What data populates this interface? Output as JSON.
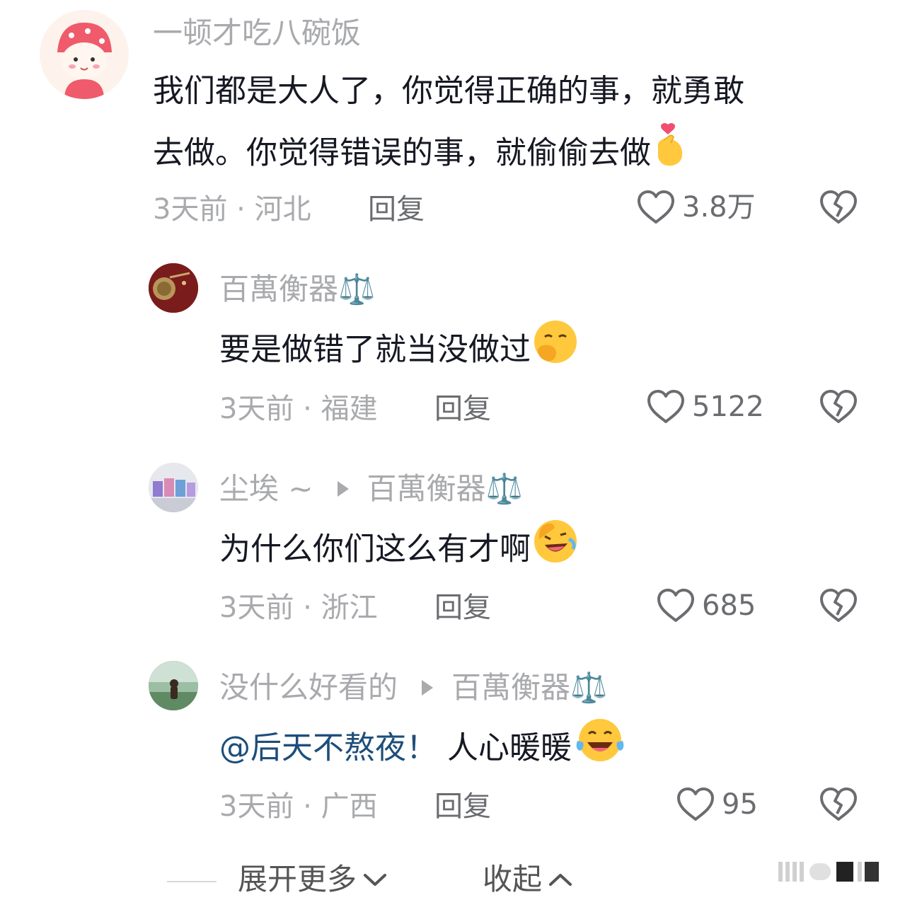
{
  "comments": [
    {
      "username": "一顿才吃八碗饭",
      "text_line1": "我们都是大人了，你觉得正确的事，就勇敢",
      "text_line2": "去做。你觉得错误的事，就偷偷去做",
      "emoji": "finger-heart-emoji",
      "time_location": "3天前 · 河北",
      "reply_label": "回复",
      "likes": "3.8万"
    },
    {
      "username": "百萬衡器⚖️",
      "text": "要是做错了就当没做过",
      "emoji": "face-with-hand-over-mouth-emoji",
      "time_location": "3天前 · 福建",
      "reply_label": "回复",
      "likes": "5122"
    },
    {
      "username": "尘埃 ~",
      "reply_to": "百萬衡器⚖️",
      "text": "为什么你们这么有才啊",
      "emoji": "rolling-laughing-emoji",
      "time_location": "3天前 · 浙江",
      "reply_label": "回复",
      "likes": "685"
    },
    {
      "username": "没什么好看的",
      "reply_to": "百萬衡器⚖️",
      "mention": "@后天不熬夜！",
      "text": " 人心暖暖",
      "emoji": "tears-of-joy-emoji",
      "time_location": "3天前 · 广西",
      "reply_label": "回复",
      "likes": "95"
    }
  ],
  "footer": {
    "expand_label": "展开更多",
    "collapse_label": "收起"
  },
  "colors": {
    "text": "#161823",
    "secondary": "#a9aaad",
    "mention": "#1d4e7a",
    "emoji_yellow": "#ffc83d"
  }
}
